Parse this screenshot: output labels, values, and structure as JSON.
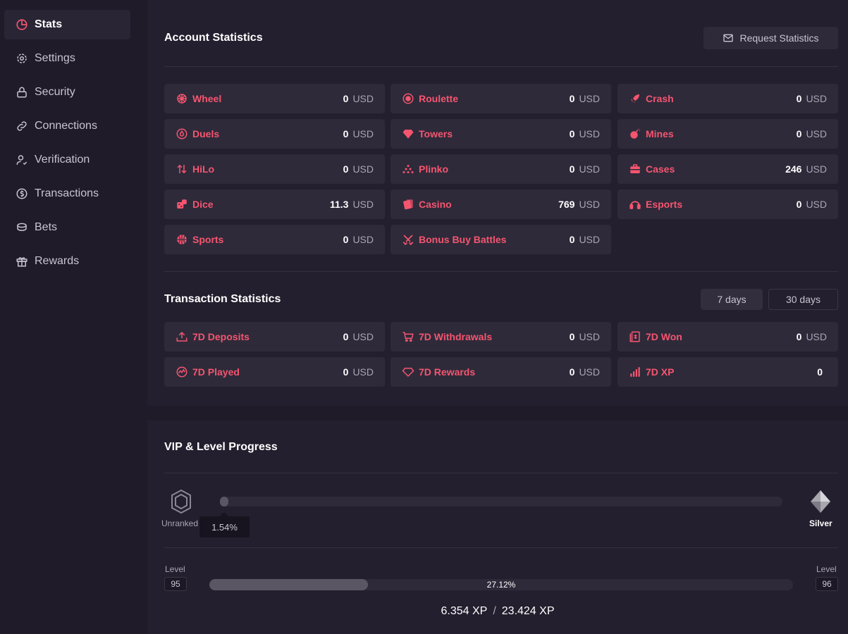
{
  "colors": {
    "accent": "#f5556f",
    "panel": "#231f2e",
    "card": "#2e2a3a",
    "background": "#1f1b29"
  },
  "sidebar": {
    "items": [
      {
        "label": "Stats",
        "icon": "pie-chart-icon",
        "active": true
      },
      {
        "label": "Settings",
        "icon": "gear-icon"
      },
      {
        "label": "Security",
        "icon": "lock-icon"
      },
      {
        "label": "Connections",
        "icon": "link-icon"
      },
      {
        "label": "Verification",
        "icon": "user-check-icon"
      },
      {
        "label": "Transactions",
        "icon": "dollar-circle-icon"
      },
      {
        "label": "Bets",
        "icon": "coins-icon"
      },
      {
        "label": "Rewards",
        "icon": "gift-icon"
      }
    ]
  },
  "account": {
    "title": "Account Statistics",
    "request_button": "Request Statistics",
    "unit": "USD",
    "items": [
      {
        "label": "Wheel",
        "value": "0",
        "icon": "wheel-icon"
      },
      {
        "label": "Roulette",
        "value": "0",
        "icon": "roulette-icon"
      },
      {
        "label": "Crash",
        "value": "0",
        "icon": "rocket-icon"
      },
      {
        "label": "Duels",
        "value": "0",
        "icon": "duels-icon"
      },
      {
        "label": "Towers",
        "value": "0",
        "icon": "diamond-icon"
      },
      {
        "label": "Mines",
        "value": "0",
        "icon": "bomb-icon"
      },
      {
        "label": "HiLo",
        "value": "0",
        "icon": "arrows-up-down-icon"
      },
      {
        "label": "Plinko",
        "value": "0",
        "icon": "plinko-icon"
      },
      {
        "label": "Cases",
        "value": "246",
        "icon": "case-icon"
      },
      {
        "label": "Dice",
        "value": "11.3",
        "icon": "dice-icon"
      },
      {
        "label": "Casino",
        "value": "769",
        "icon": "cards-icon"
      },
      {
        "label": "Esports",
        "value": "0",
        "icon": "headset-icon"
      },
      {
        "label": "Sports",
        "value": "0",
        "icon": "basketball-icon"
      },
      {
        "label": "Bonus Buy Battles",
        "value": "0",
        "icon": "swords-icon"
      }
    ]
  },
  "transactions": {
    "title": "Transaction Statistics",
    "tab_7": "7 days",
    "tab_30": "30 days",
    "unit": "USD",
    "items": [
      {
        "label": "7D Deposits",
        "value": "0",
        "icon": "upload-icon",
        "unit": "USD"
      },
      {
        "label": "7D Withdrawals",
        "value": "0",
        "icon": "cart-icon",
        "unit": "USD"
      },
      {
        "label": "7D Won",
        "value": "0",
        "icon": "money-stack-icon",
        "unit": "USD"
      },
      {
        "label": "7D Played",
        "value": "0",
        "icon": "activity-icon",
        "unit": "USD"
      },
      {
        "label": "7D Rewards",
        "value": "0",
        "icon": "diamond-outline-icon",
        "unit": "USD"
      },
      {
        "label": "7D XP",
        "value": "0",
        "icon": "bar-chart-icon",
        "unit": ""
      }
    ]
  },
  "vip": {
    "title": "VIP & Level Progress",
    "current_rank": "Unranked",
    "next_rank": "Silver",
    "progress_label": "1.54%",
    "progress": 0.0154,
    "level_caption": "Level",
    "current_level": "95",
    "next_level": "96",
    "level_progress_label": "27.12%",
    "level_progress": 0.2712,
    "xp_current": "6.354 XP",
    "xp_separator": "/",
    "xp_total": "23.424 XP"
  }
}
